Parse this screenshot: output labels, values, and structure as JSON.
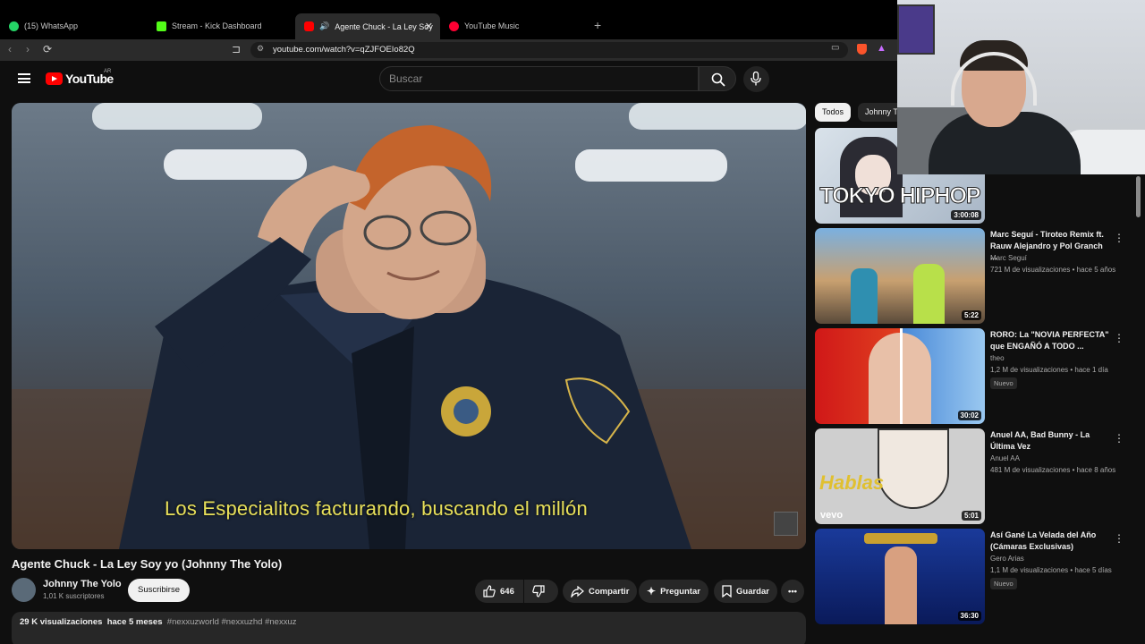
{
  "browser": {
    "tabs": [
      {
        "label": "(15) WhatsApp",
        "color": "#25d366"
      },
      {
        "label": "Stream - Kick Dashboard",
        "color": "#53fc18"
      },
      {
        "label": "Agente Chuck - La Ley Soy yo",
        "color": "#ff0000"
      },
      {
        "label": "YouTube Music",
        "color": "#ff0033"
      }
    ],
    "new_tab": "+",
    "close": "✕",
    "url": "youtube.com/watch?v=qZJFOEIo82Q"
  },
  "header": {
    "logo": "YouTube",
    "region": "AR",
    "search_placeholder": "Buscar"
  },
  "player": {
    "caption": "Los Especialitos facturando, buscando el millón"
  },
  "video": {
    "title": "Agente Chuck - La Ley Soy yo (Johnny The Yolo)",
    "channel": "Johnny The Yolo",
    "subscribers": "1,01 K suscriptores",
    "subscribe": "Suscribirse",
    "likes": "646",
    "share": "Compartir",
    "ask": "Preguntar",
    "save": "Guardar",
    "views": "29 K visualizaciones",
    "age": "hace 5 meses",
    "tags": "#nexxuzworld #nexxuzhd #nexxuz"
  },
  "chips": [
    "Todos",
    "Johnny T"
  ],
  "recommendations": [
    {
      "title": "",
      "channel": "",
      "meta": "",
      "duration": "3:00:08",
      "thumb_text": "TOKYO HIPHOP",
      "badge": ""
    },
    {
      "title": "Marc Seguí - Tiroteo Remix ft. Rauw Alejandro y Pol Granch ...",
      "channel": "Marc Seguí",
      "meta": "721 M de visualizaciones • hace 5 años",
      "duration": "5:22",
      "thumb_text": "",
      "badge": ""
    },
    {
      "title": "RORO: La \"NOVIA PERFECTA\" que ENGAÑÓ A TODO ...",
      "channel": "theo",
      "meta": "1,2 M de visualizaciones • hace 1 día",
      "duration": "30:02",
      "thumb_text": "",
      "badge": "Nuevo"
    },
    {
      "title": "Anuel AA, Bad Bunny - La Última Vez",
      "channel": "Anuel AA",
      "meta": "481 M de visualizaciones • hace 8 años",
      "duration": "5:01",
      "thumb_text": "Hablas",
      "badge": ""
    },
    {
      "title": "Así Gané La Velada del Año (Cámaras Exclusivas)",
      "channel": "Gero Arias",
      "meta": "1,1 M de visualizaciones • hace 5 días",
      "duration": "36:30",
      "thumb_text": "",
      "badge": "Nuevo"
    }
  ]
}
